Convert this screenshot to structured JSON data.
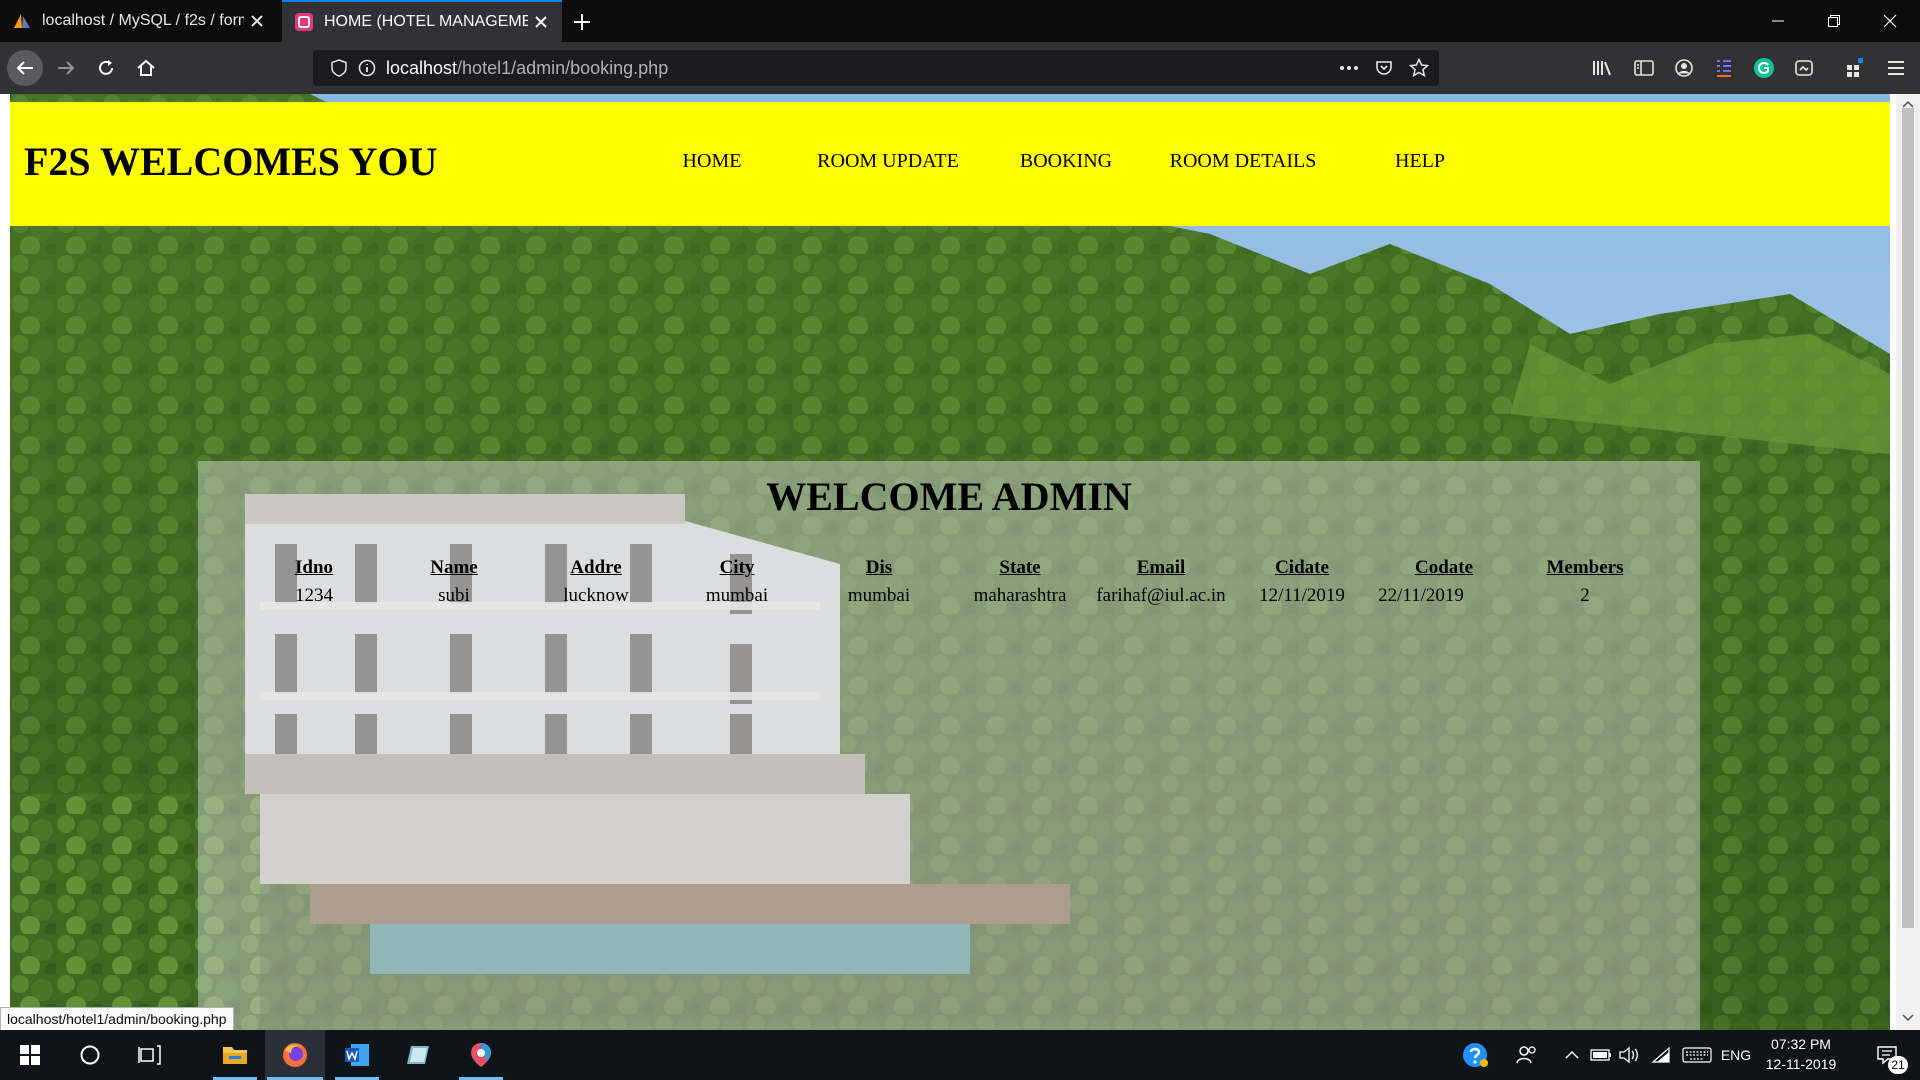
{
  "browser": {
    "tabs": [
      {
        "title": "localhost / MySQL / f2s / form",
        "active": false,
        "icon": "phpmyadmin-sail-icon"
      },
      {
        "title": "HOME (HOTEL MANAGEMENT)",
        "active": true,
        "icon": "pink-site-icon"
      }
    ],
    "url_host": "localhost",
    "url_path": "/hotel1/admin/booking.php",
    "status_url": "localhost/hotel1/admin/booking.php",
    "accent": "#0a84ff"
  },
  "site": {
    "title": "F2S WELCOMES YOU",
    "nav": [
      "HOME",
      "ROOM UPDATE",
      "BOOKING",
      "ROOM DETAILS",
      "HELP"
    ],
    "header_color": "#ffff00"
  },
  "admin": {
    "heading": "WELCOME ADMIN",
    "table": {
      "headers": [
        "Idno",
        "Name",
        "Addre",
        "City",
        "Dis",
        "State",
        "Email",
        "Cidate",
        "Codate",
        "Members"
      ],
      "rows": [
        [
          "1234",
          "subi",
          "lucknow",
          "mumbai",
          "mumbai",
          "maharashtra",
          "farihaf@iul.ac.in",
          "12/11/2019",
          "22/11/2019",
          "2"
        ]
      ]
    }
  },
  "taskbar": {
    "language": "ENG",
    "time": "07:32 PM",
    "date": "12-11-2019",
    "notification_count": "21"
  }
}
